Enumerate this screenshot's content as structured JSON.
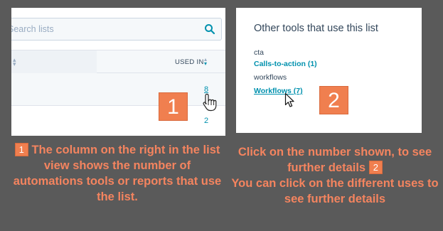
{
  "left_panel": {
    "search": {
      "placeholder": "Search lists"
    },
    "table": {
      "header": {
        "used_in_label": "USED IN"
      },
      "rows": [
        {
          "used_in": "8"
        },
        {
          "used_in": "2"
        }
      ]
    },
    "step_badge": "1"
  },
  "right_panel": {
    "title": "Other tools that use this list",
    "items": [
      {
        "category": "cta",
        "link": "Calls-to-action (1)"
      },
      {
        "category": "workflows",
        "link": "Workflows (7)"
      }
    ],
    "step_badge": "2"
  },
  "captions": {
    "left": {
      "badge": "1",
      "text": "The column on the right in the list view shows the number of automations tools or reports that use the list."
    },
    "right": {
      "line1": "Click on the number shown, to see further details",
      "badge": "2",
      "line2": "You can click on the different uses to see further details"
    }
  },
  "colors": {
    "background": "#5a5a5a",
    "accent_orange": "#f07f4f",
    "caption_text": "#f4845f",
    "link_teal": "#0091ae",
    "text_dark": "#33475b"
  },
  "icons": {
    "search": "search-icon",
    "cursor_hand": "hand-cursor-icon",
    "cursor_arrow": "arrow-cursor-icon"
  }
}
